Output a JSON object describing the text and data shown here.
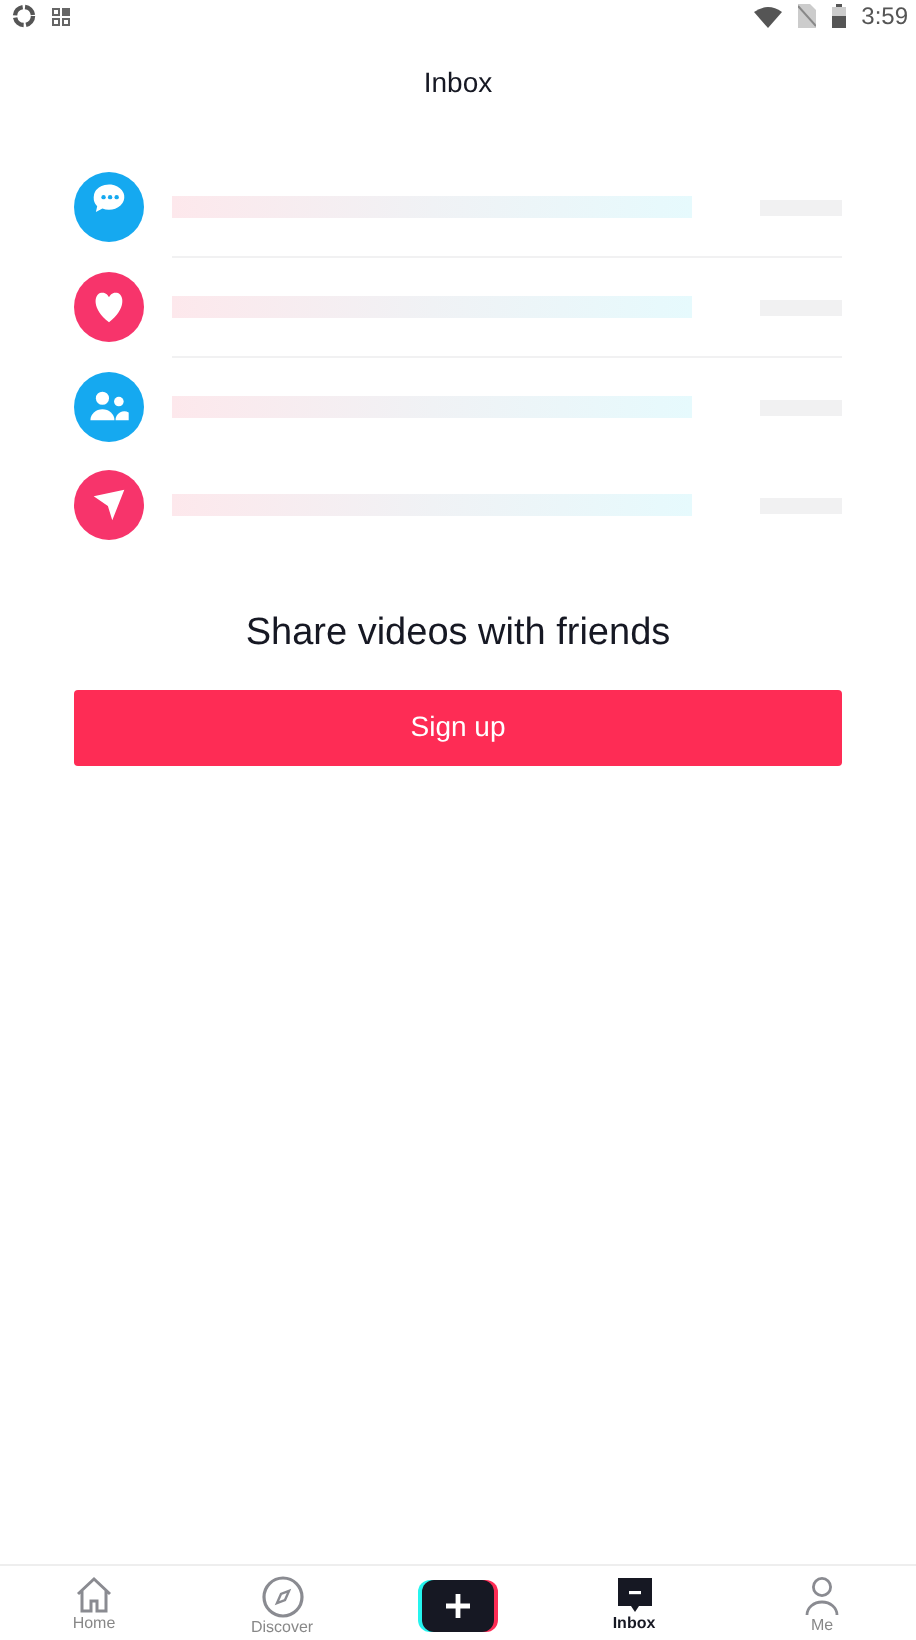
{
  "status_bar": {
    "time": "3:59"
  },
  "header": {
    "title": "Inbox"
  },
  "rows": [
    {
      "kind": "comment",
      "color": "#15a9f0"
    },
    {
      "kind": "heart",
      "color": "#f7346b"
    },
    {
      "kind": "people",
      "color": "#15a9f0"
    },
    {
      "kind": "send",
      "color": "#f7346b"
    }
  ],
  "prompt": {
    "heading": "Share videos with friends",
    "button": "Sign up"
  },
  "tab_bar": [
    {
      "kind": "home",
      "label": "Home",
      "selected": false
    },
    {
      "kind": "discover",
      "label": "Discover",
      "selected": false
    },
    {
      "kind": "create"
    },
    {
      "kind": "inbox",
      "label": "Inbox",
      "selected": true
    },
    {
      "kind": "me",
      "label": "Me",
      "selected": false
    }
  ]
}
